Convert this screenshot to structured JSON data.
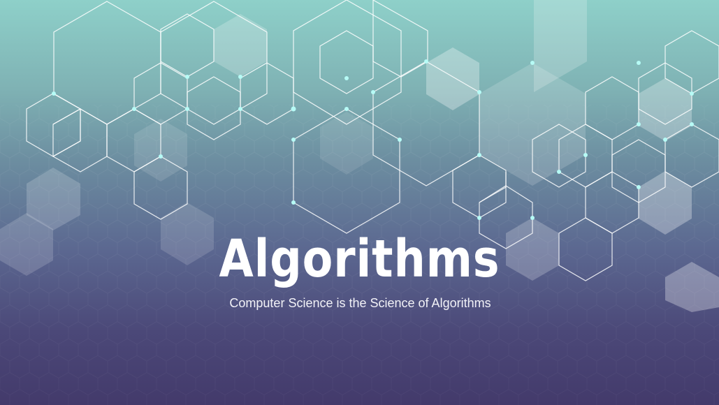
{
  "slide": {
    "title": "Algorithms",
    "subtitle": "Computer Science is the Science of Algorithms"
  },
  "background": {
    "decoration": "hexagon-network-pattern",
    "colors": {
      "gradient_top": "#8ed0c9",
      "gradient_bottom": "#433a6b",
      "line": "#ffffff",
      "node": "#a8f4f0",
      "text": "#ffffff"
    }
  }
}
